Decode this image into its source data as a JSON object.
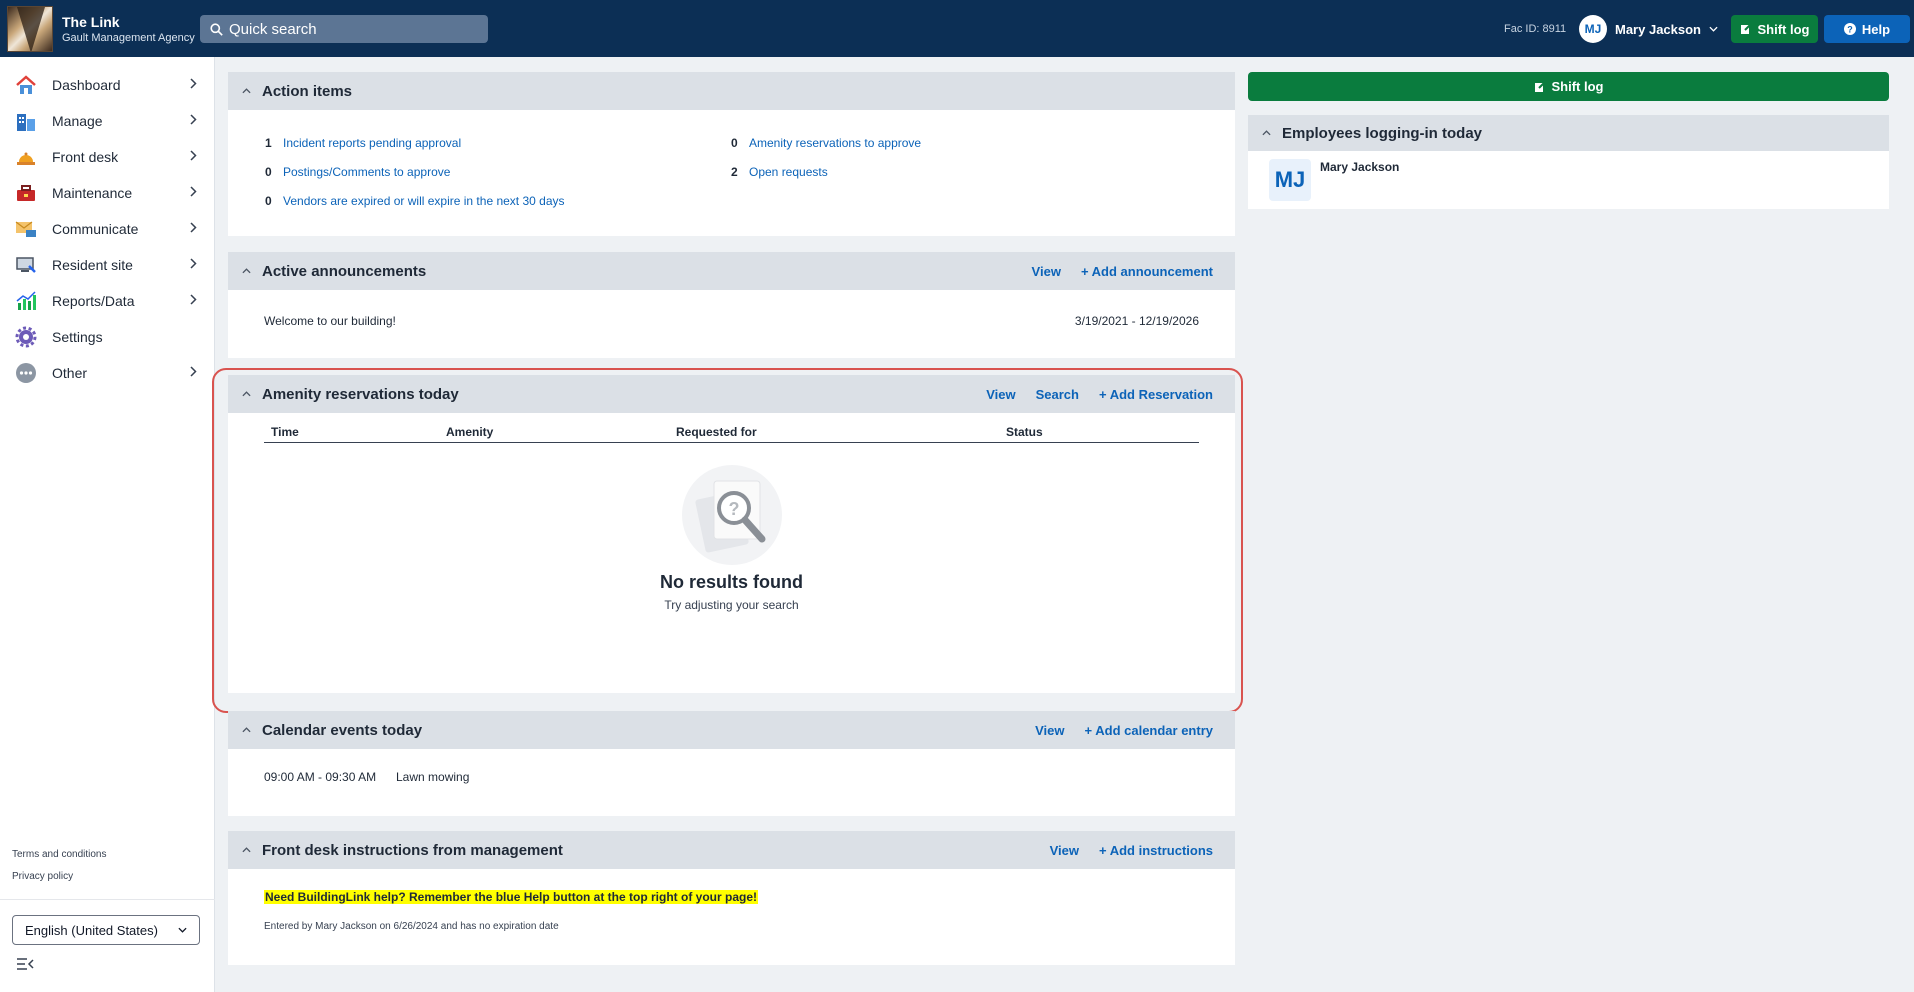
{
  "app": {
    "name": "The Link",
    "org": "Gault Management Agency"
  },
  "search": {
    "placeholder": "Quick search"
  },
  "header": {
    "fac_id": "Fac ID: 8911",
    "user_initials": "MJ",
    "user_name": "Mary Jackson",
    "shift_log": "Shift log",
    "help": "Help"
  },
  "sidebar": {
    "items": [
      {
        "label": "Dashboard",
        "icon": "house-icon"
      },
      {
        "label": "Manage",
        "icon": "building-icon"
      },
      {
        "label": "Front desk",
        "icon": "bell-icon"
      },
      {
        "label": "Maintenance",
        "icon": "toolbox-icon"
      },
      {
        "label": "Communicate",
        "icon": "envelope-icon"
      },
      {
        "label": "Resident site",
        "icon": "monitor-icon"
      },
      {
        "label": "Reports/Data",
        "icon": "chart-icon"
      },
      {
        "label": "Settings",
        "icon": "gear-icon"
      },
      {
        "label": "Other",
        "icon": "more-icon"
      }
    ],
    "terms": "Terms and conditions",
    "privacy": "Privacy policy",
    "language": "English (United States)"
  },
  "action_items": {
    "title": "Action items",
    "items": [
      {
        "count": "1",
        "label": "Incident reports pending approval"
      },
      {
        "count": "0",
        "label": "Postings/Comments to approve"
      },
      {
        "count": "0",
        "label": "Vendors are expired or will expire in the next 30 days"
      },
      {
        "count": "0",
        "label": "Amenity reservations to approve"
      },
      {
        "count": "2",
        "label": "Open requests"
      }
    ]
  },
  "announcements": {
    "title": "Active announcements",
    "view": "View",
    "add": "+ Add announcement",
    "item_text": "Welcome to our building!",
    "item_dates": "3/19/2021 - 12/19/2026"
  },
  "amenity": {
    "title": "Amenity reservations today",
    "view": "View",
    "search": "Search",
    "add": "+ Add Reservation",
    "columns": [
      "Time",
      "Amenity",
      "Requested for",
      "Status"
    ],
    "empty_title": "No results found",
    "empty_sub": "Try adjusting your search"
  },
  "calendar": {
    "title": "Calendar events today",
    "view": "View",
    "add": "+ Add calendar entry",
    "event_time": "09:00 AM - 09:30 AM",
    "event_name": "Lawn mowing"
  },
  "frontdesk": {
    "title": "Front desk instructions from management",
    "view": "View",
    "add": "+ Add instructions",
    "notice": "Need BuildingLink help? Remember the blue Help button at the top right of your page!",
    "entered": "Entered by Mary Jackson on 6/26/2024 and has no expiration date"
  },
  "right": {
    "shift_log": "Shift log",
    "employees_title": "Employees logging-in today",
    "employee_initials": "MJ",
    "employee_name": "Mary Jackson"
  }
}
